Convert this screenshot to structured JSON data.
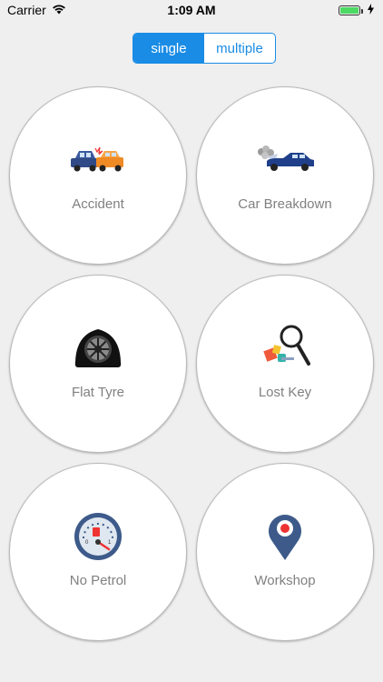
{
  "status": {
    "carrier": "Carrier",
    "time": "1:09 AM"
  },
  "mode": {
    "options": [
      "single",
      "multiple"
    ],
    "selected": "single"
  },
  "services": [
    {
      "label": "Accident",
      "icon": "car-accident-icon"
    },
    {
      "label": "Car Breakdown",
      "icon": "car-breakdown-icon"
    },
    {
      "label": "Flat Tyre",
      "icon": "flat-tyre-icon"
    },
    {
      "label": "Lost Key",
      "icon": "lost-key-icon"
    },
    {
      "label": "No Petrol",
      "icon": "fuel-gauge-icon"
    },
    {
      "label": "Workshop",
      "icon": "map-pin-icon"
    }
  ],
  "colors": {
    "accent": "#1a8ce5",
    "background": "#efefef",
    "label": "#808080"
  }
}
